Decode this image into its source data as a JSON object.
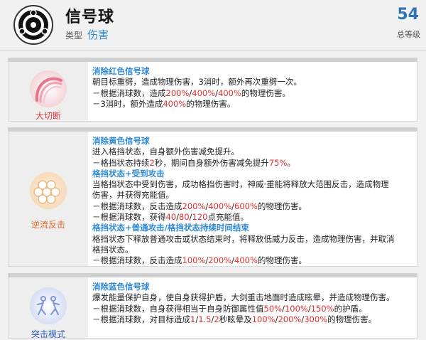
{
  "header": {
    "title": "信号球",
    "type_label": "类型",
    "type_value": "伤害",
    "level_value": "54",
    "level_label": "总等级"
  },
  "cards": [
    {
      "skill_name": "大切断",
      "name_color": "#d63c3c",
      "icon": "red-crescent-slash-icon",
      "lines": [
        {
          "kind": "head",
          "text": "消除红色信号球"
        },
        {
          "kind": "text",
          "segments": [
            {
              "t": "朝目标重劈，造成物理伤害，3消时，额外再次重劈一次。"
            }
          ]
        },
        {
          "kind": "text",
          "segments": [
            {
              "t": "－根据消球数，造成"
            },
            {
              "t": "200%",
              "c": "red"
            },
            {
              "t": "/"
            },
            {
              "t": "400%",
              "c": "red"
            },
            {
              "t": "/"
            },
            {
              "t": "400%",
              "c": "red"
            },
            {
              "t": "的物理伤害。"
            }
          ]
        },
        {
          "kind": "text",
          "segments": [
            {
              "t": "－3消时，额外造成"
            },
            {
              "t": "400%",
              "c": "red"
            },
            {
              "t": "的物理伤害。"
            }
          ]
        }
      ]
    },
    {
      "skill_name": "逆流反击",
      "name_color": "#e46a2a",
      "icon": "orange-honeycomb-shield-icon",
      "lines": [
        {
          "kind": "head",
          "text": "消除黄色信号球"
        },
        {
          "kind": "text",
          "segments": [
            {
              "t": "进入格挡状态，自身额外伤害减免提升。"
            }
          ]
        },
        {
          "kind": "text",
          "segments": [
            {
              "t": "－格挡状态持续"
            },
            {
              "t": "2",
              "c": "red"
            },
            {
              "t": "秒，期间自身额外伤害减免提升"
            },
            {
              "t": "75%",
              "c": "red"
            },
            {
              "t": "。"
            }
          ]
        },
        {
          "kind": "head",
          "text": "格挡状态+受到攻击"
        },
        {
          "kind": "text",
          "segments": [
            {
              "t": "当格挡状态中受到伤害，成功格挡伤害时，神威·重能将释放大范围反击，造成物理"
            }
          ]
        },
        {
          "kind": "text",
          "segments": [
            {
              "t": "伤害，并获得充能值。"
            }
          ]
        },
        {
          "kind": "text",
          "segments": [
            {
              "t": "－根据消球数，反击造成"
            },
            {
              "t": "200%",
              "c": "red"
            },
            {
              "t": "/"
            },
            {
              "t": "400%",
              "c": "red"
            },
            {
              "t": "/"
            },
            {
              "t": "600%",
              "c": "red"
            },
            {
              "t": "的物理伤害。"
            }
          ]
        },
        {
          "kind": "text",
          "segments": [
            {
              "t": "－根据消球数，获得"
            },
            {
              "t": "40",
              "c": "red"
            },
            {
              "t": "/"
            },
            {
              "t": "80",
              "c": "red"
            },
            {
              "t": "/"
            },
            {
              "t": "120",
              "c": "red"
            },
            {
              "t": "点充能值。"
            }
          ]
        },
        {
          "kind": "head",
          "text": "格挡状态+普通攻击/格挡状态持续时间结束"
        },
        {
          "kind": "text",
          "segments": [
            {
              "t": "格挡状态下释放普通攻击或状态结束时，将释放低威力反击，造成物理伤害，并取消"
            }
          ]
        },
        {
          "kind": "text",
          "segments": [
            {
              "t": "格挡状态。"
            }
          ]
        },
        {
          "kind": "text",
          "segments": [
            {
              "t": "－根据消球数，反击造成"
            },
            {
              "t": "100%",
              "c": "red"
            },
            {
              "t": "/"
            },
            {
              "t": "200%",
              "c": "red"
            },
            {
              "t": "/"
            },
            {
              "t": "400%",
              "c": "red"
            },
            {
              "t": "的物理伤害。"
            }
          ]
        }
      ]
    },
    {
      "skill_name": "突击模式",
      "name_color": "#2f5fb8",
      "icon": "blue-charging-figures-icon",
      "lines": [
        {
          "kind": "head",
          "text": "消除蓝色信号球"
        },
        {
          "kind": "text",
          "segments": [
            {
              "t": "爆发能量保护自身，使自身获得护盾，大剑重击地面时造成眩晕，并造成物理伤害。"
            }
          ]
        },
        {
          "kind": "text",
          "segments": [
            {
              "t": "－根据消球数，自身获得相当于自身防御属性值"
            },
            {
              "t": "50%",
              "c": "red"
            },
            {
              "t": "/"
            },
            {
              "t": "100%",
              "c": "red"
            },
            {
              "t": "/"
            },
            {
              "t": "150%",
              "c": "red"
            },
            {
              "t": "的护盾。"
            }
          ]
        },
        {
          "kind": "text",
          "segments": [
            {
              "t": "－根据消球数，对目标造成"
            },
            {
              "t": "1",
              "c": "red"
            },
            {
              "t": "/"
            },
            {
              "t": "1.5",
              "c": "red"
            },
            {
              "t": "/"
            },
            {
              "t": "2",
              "c": "red"
            },
            {
              "t": "秒眩晕及"
            },
            {
              "t": "100%",
              "c": "red"
            },
            {
              "t": "/"
            },
            {
              "t": "200%",
              "c": "red"
            },
            {
              "t": "/"
            },
            {
              "t": "300%",
              "c": "red"
            },
            {
              "t": "的物理伤害。"
            }
          ]
        }
      ]
    }
  ]
}
